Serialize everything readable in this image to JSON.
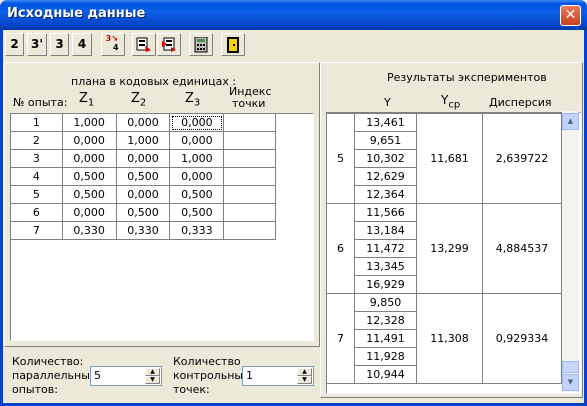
{
  "window": {
    "title": "Исходные данные",
    "close_glyph": "✕"
  },
  "toolbar": {
    "b2": "2",
    "b3p": "3'",
    "b3": "3",
    "b4": "4",
    "icons": [
      "swap-icon",
      "copy-data-icon",
      "paste-data-icon",
      "calculator-icon",
      "exit-door-icon"
    ],
    "swap_top": "3",
    "swap_bottom": "4"
  },
  "left": {
    "header_plan": "плана в кодовых единицах :",
    "col_num": "№ опыта:",
    "z1": "Z",
    "z1_sub": "1",
    "z2": "Z",
    "z2_sub": "2",
    "z3": "Z",
    "z3_sub": "3",
    "idx1": "Индекс",
    "idx2": "точки",
    "rows": [
      [
        "1",
        "1,000",
        "0,000",
        "0,000"
      ],
      [
        "2",
        "0,000",
        "1,000",
        "0,000"
      ],
      [
        "3",
        "0,000",
        "0,000",
        "1,000"
      ],
      [
        "4",
        "0,500",
        "0,500",
        "0,000"
      ],
      [
        "5",
        "0,500",
        "0,000",
        "0,500"
      ],
      [
        "6",
        "0,000",
        "0,500",
        "0,500"
      ],
      [
        "7",
        "0,330",
        "0,330",
        "0,333"
      ]
    ]
  },
  "right": {
    "header": "Результаты экспериментов",
    "col_y": "Y",
    "col_ycp": "Y",
    "col_ycp_sub": "cp",
    "col_disp": "Дисперсия",
    "groups": [
      {
        "n": "5",
        "y": [
          "13,461",
          "9,651",
          "10,302",
          "12,629",
          "12,364"
        ],
        "ycp": "11,681",
        "disp": "2,639722"
      },
      {
        "n": "6",
        "y": [
          "11,566",
          "13,184",
          "11,472",
          "13,345",
          "16,929"
        ],
        "ycp": "13,299",
        "disp": "4,884537"
      },
      {
        "n": "7",
        "y": [
          "9,850",
          "12,328",
          "11,491",
          "11,928",
          "10,944"
        ],
        "ycp": "11,308",
        "disp": "0,929334"
      }
    ]
  },
  "bottom": {
    "par1": "Количество:",
    "par2": "параллельных",
    "par3": "опытов:",
    "par_value": "5",
    "ctl1": "Количество",
    "ctl2": "контрольных",
    "ctl3": "точек:",
    "ctl_value": "1"
  }
}
